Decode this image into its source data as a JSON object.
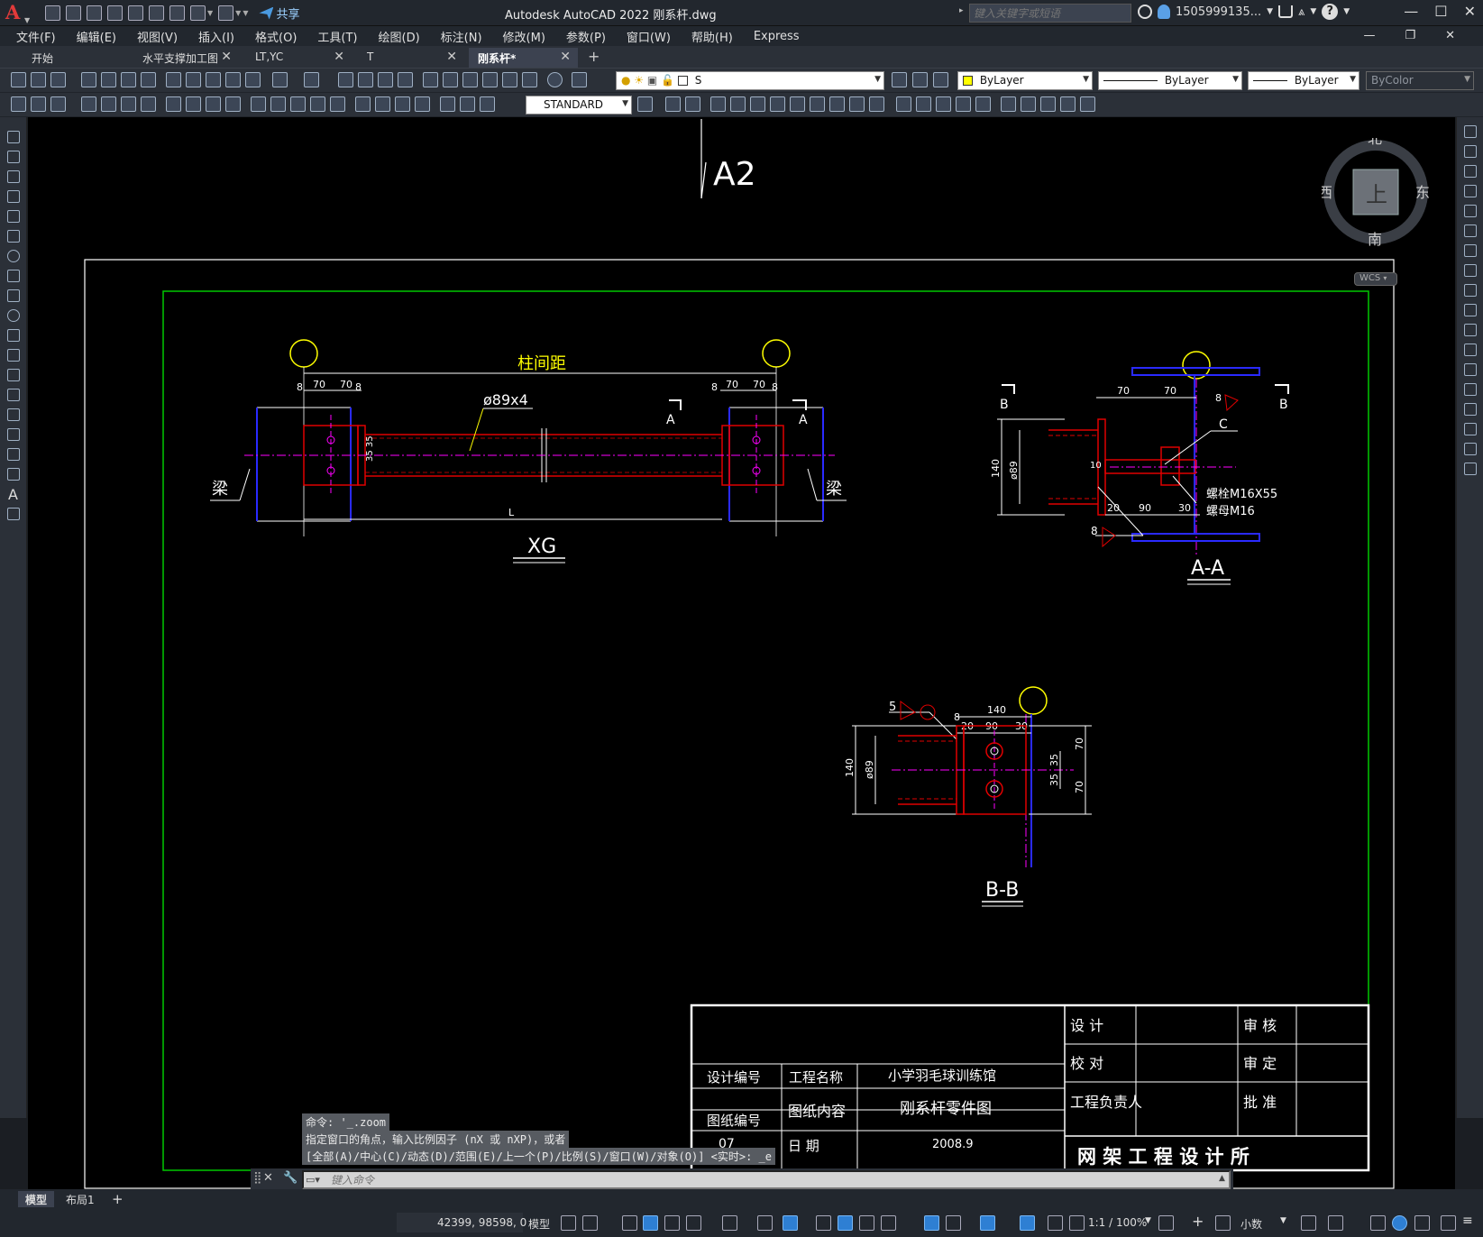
{
  "app": {
    "logo": "A",
    "title": "Autodesk AutoCAD 2022    刚系杆.dwg",
    "share": "共享",
    "search_placeholder": "键入关键字或短语",
    "user": "1505999135...",
    "window_controls": [
      "—",
      "☐",
      "✕"
    ]
  },
  "menu": [
    "文件(F)",
    "编辑(E)",
    "视图(V)",
    "插入(I)",
    "格式(O)",
    "工具(T)",
    "绘图(D)",
    "标注(N)",
    "修改(M)",
    "参数(P)",
    "窗口(W)",
    "帮助(H)",
    "Express"
  ],
  "doc_tabs": [
    {
      "label": "开始",
      "closable": false,
      "active": false
    },
    {
      "label": "水平支撑加工图",
      "closable": true,
      "active": false
    },
    {
      "label": "LT,YC",
      "closable": true,
      "active": false
    },
    {
      "label": "T",
      "closable": true,
      "active": false
    },
    {
      "label": "刚系杆*",
      "closable": true,
      "active": true
    }
  ],
  "properties": {
    "layer": "S",
    "color": "ByLayer",
    "linetype": "ByLayer",
    "lineweight": "ByLayer",
    "plotstyle": "ByColor",
    "textstyle": "STANDARD"
  },
  "viewcube": {
    "north": "北",
    "south": "南",
    "east": "东",
    "west": "西",
    "face": "上",
    "ucs": "WCS"
  },
  "drawing": {
    "sheet": "A2",
    "xg": {
      "title": "XG",
      "span": "柱间距",
      "pipe": "ø89x4",
      "beam": "梁",
      "length": "L",
      "section": "A",
      "dims": [
        "8",
        "70",
        "70",
        "8"
      ],
      "bolt_dims": "35 35"
    },
    "aa": {
      "title": "A-A",
      "label": "B",
      "dims": [
        "70",
        "70",
        "8"
      ],
      "c": "C",
      "bolt": "螺栓M16X55",
      "nut": "螺母M16",
      "d140": "140",
      "d89": "ø89",
      "d10": "10",
      "bottom_dims": [
        "20",
        "90",
        "30"
      ],
      "d8": "8"
    },
    "bb": {
      "title": "B-B",
      "d5": "5",
      "top": "140",
      "top_dims": [
        "8",
        "20",
        "90",
        "30"
      ],
      "d140": "140",
      "d89": "ø89",
      "right_a": [
        "35",
        "35"
      ],
      "right_b": [
        "70",
        "70"
      ]
    }
  },
  "titleblock": {
    "design": "设  计",
    "check": "校  对",
    "manager": "工程负责人",
    "review": "审  核",
    "approve": "审  定",
    "authorize": "批  准",
    "design_no": "设计编号",
    "drawing_no": "图纸编号",
    "project_name_label": "工程名称",
    "project_name": "小学羽毛球训练馆",
    "content_label": "图纸内容",
    "content": "刚系杆零件图",
    "date_label": "日  期",
    "date": "2008.9",
    "number": "07",
    "institute": "网 架 工 程 设 计 所"
  },
  "command": {
    "history": [
      "命令: '_.zoom",
      "指定窗口的角点，输入比例因子 (nX 或 nXP)，或者",
      "[全部(A)/中心(C)/动态(D)/范围(E)/上一个(P)/比例(S)/窗口(W)/对象(O)] <实时>: _e"
    ],
    "placeholder": "键入命令"
  },
  "layouts": [
    {
      "label": "模型",
      "active": true
    },
    {
      "label": "布局1",
      "active": false
    }
  ],
  "status": {
    "coords": "42399, 98598, 0",
    "mode": "模型",
    "scale": "1:1 / 100%",
    "units": "小数"
  },
  "colors": {
    "bg": "#000000",
    "green": "#00c800",
    "red": "#e00000",
    "yellow": "#ffff00",
    "blue": "#2a2aff",
    "magenta": "#ff00ff",
    "white": "#ffffff"
  }
}
